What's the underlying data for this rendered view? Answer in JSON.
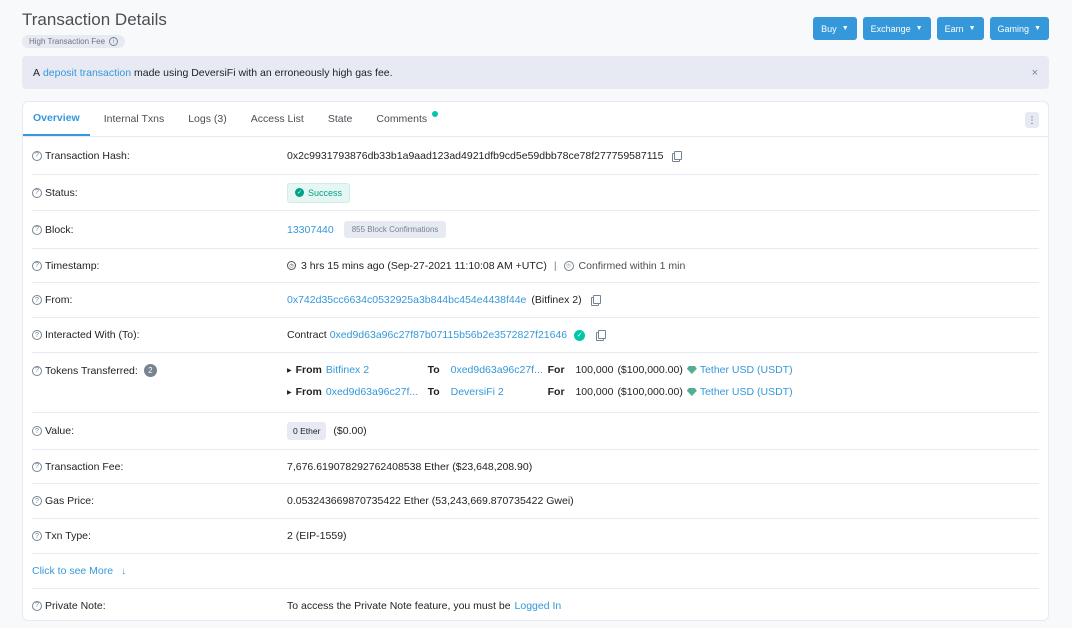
{
  "header": {
    "title": "Transaction Details",
    "fee_badge": "High Transaction Fee"
  },
  "nav_buttons": [
    {
      "label": "Buy"
    },
    {
      "label": "Exchange"
    },
    {
      "label": "Earn"
    },
    {
      "label": "Gaming"
    }
  ],
  "alert": {
    "prefix": "A",
    "link": "deposit transaction",
    "suffix": "made using DeversiFi with an erroneously high gas fee.",
    "close": "×"
  },
  "tabs": [
    {
      "label": "Overview",
      "active": true
    },
    {
      "label": "Internal Txns"
    },
    {
      "label": "Logs (3)"
    },
    {
      "label": "Access List"
    },
    {
      "label": "State"
    },
    {
      "label": "Comments"
    }
  ],
  "rows": {
    "tx_hash": {
      "label": "Transaction Hash:",
      "value": "0x2c9931793876db33b1a9aad123ad4921dfb9cd5e59dbb78ce78f277759587115"
    },
    "status": {
      "label": "Status:",
      "value": "Success"
    },
    "block": {
      "label": "Block:",
      "value": "13307440",
      "confirmations": "855 Block Confirmations"
    },
    "timestamp": {
      "label": "Timestamp:",
      "value": "3 hrs 15 mins ago (Sep-27-2021 11:10:08 AM +UTC)",
      "separator": "|",
      "confirmed": "Confirmed within 1 min"
    },
    "from": {
      "label": "From:",
      "address": "0x742d35cc6634c0532925a3b844bc454e4438f44e",
      "name": "(Bitfinex 2)"
    },
    "to": {
      "label": "Interacted With (To):",
      "prefix": "Contract",
      "address": "0xed9d63a96c27f87b07115b56b2e3572827f21646"
    },
    "tokens": {
      "label": "Tokens Transferred:",
      "count": "2",
      "transfers": [
        {
          "from_label": "From",
          "from": "Bitfinex 2",
          "to_label": "To",
          "to": "0xed9d63a96c27f...",
          "for_label": "For",
          "amount": "100,000",
          "usd": "($100,000.00)",
          "token": "Tether USD (USDT)"
        },
        {
          "from_label": "From",
          "from": "0xed9d63a96c27f...",
          "to_label": "To",
          "to": "DeversiFi 2",
          "for_label": "For",
          "amount": "100,000",
          "usd": "($100,000.00)",
          "token": "Tether USD (USDT)"
        }
      ]
    },
    "value": {
      "label": "Value:",
      "ether": "0 Ether",
      "usd": "($0.00)"
    },
    "fee": {
      "label": "Transaction Fee:",
      "value": "7,676.619078292762408538 Ether ($23,648,208.90)"
    },
    "gas_price": {
      "label": "Gas Price:",
      "value": "0.053243669870735422 Ether (53,243,669.870735422 Gwei)"
    },
    "txn_type": {
      "label": "Txn Type:",
      "value": "2 (EIP-1559)"
    },
    "see_more": {
      "label": "Click to see More"
    },
    "private_note": {
      "label": "Private Note:",
      "text": "To access the Private Note feature, you must be",
      "link": "Logged In"
    }
  },
  "colors": {
    "accent": "#3498db",
    "success": "#00a186",
    "background": "#f8f9fa"
  }
}
